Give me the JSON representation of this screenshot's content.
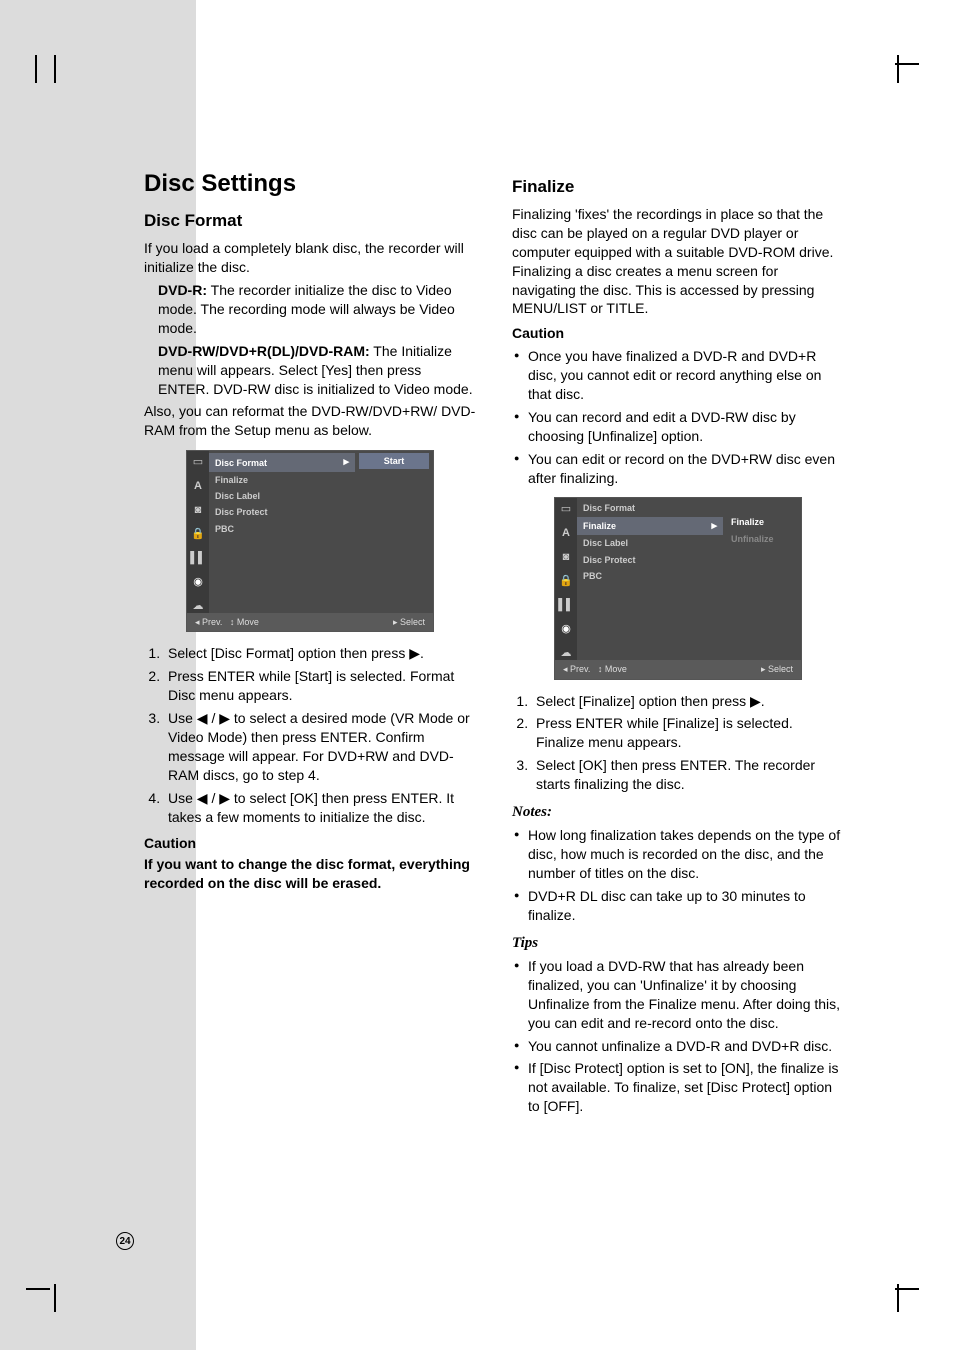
{
  "page_number": "24",
  "left": {
    "title": "Disc Settings",
    "h2": "Disc Format",
    "intro": "If you load a completely blank disc, the recorder will initialize the disc.",
    "dvd_r_label": "DVD-R:",
    "dvd_r_text": " The recorder initialize the disc to Video mode. The recording mode will always be Video mode.",
    "dvd_rw_label": "DVD-RW/DVD+R(DL)/DVD-RAM:",
    "dvd_rw_text": " The Initialize menu will appears. Select [Yes] then press ENTER. DVD-RW disc is initialized to Video mode.",
    "also": "Also, you can reformat the DVD-RW/DVD+RW/ DVD-RAM from the Setup menu as below.",
    "steps": [
      "Select [Disc Format] option then press ▶.",
      "Press ENTER while [Start] is selected. Format Disc menu appears.",
      "Use ◀ / ▶ to select a desired mode (VR Mode or Video Mode) then press ENTER. Confirm message will appear. For DVD+RW and DVD-RAM discs, go to step 4.",
      "Use ◀ / ▶ to select [OK] then press ENTER. It takes a few moments to initialize the disc."
    ],
    "caution_label": "Caution",
    "caution_text": "If you want to change the disc format, everything recorded on the disc will be erased."
  },
  "right": {
    "h2": "Finalize",
    "intro": "Finalizing 'fixes' the recordings in place so that the disc can be played on a regular DVD player or computer equipped with a suitable DVD-ROM drive. Finalizing a disc creates a menu screen for navigating the disc. This is accessed by pressing MENU/LIST or TITLE.",
    "caution_label": "Caution",
    "caution_bullets": [
      "Once you have finalized a DVD-R and DVD+R disc, you cannot edit or record anything else on that disc.",
      "You can record and edit a DVD-RW disc by choosing [Unfinalize] option.",
      "You can edit or record on the DVD+RW disc even after finalizing."
    ],
    "steps": [
      "Select [Finalize] option then press ▶.",
      "Press ENTER while [Finalize] is selected. Finalize menu appears.",
      "Select [OK] then press ENTER. The recorder starts finalizing the disc."
    ],
    "notes_label": "Notes:",
    "notes_bullets": [
      "How long finalization takes depends on the type of disc, how much is recorded on the disc, and the number of titles on the disc.",
      "DVD+R DL disc can take up to 30 minutes to finalize."
    ],
    "tips_label": "Tips",
    "tips_bullets": [
      "If you load a DVD-RW that has already been finalized, you can 'Unfinalize' it by choosing Unfinalize from the Finalize menu. After doing this, you can edit and re-record onto the disc.",
      "You cannot unfinalize a DVD-R and DVD+R disc.",
      "If [Disc Protect] option is set to [ON], the finalize is not available. To finalize, set [Disc Protect] option to [OFF]."
    ]
  },
  "osd": {
    "menu_items": [
      "Disc Format",
      "Finalize",
      "Disc Label",
      "Disc Protect",
      "PBC"
    ],
    "start_btn": "Start",
    "finalize_btn": "Finalize",
    "unfinalize_btn": "Unfinalize",
    "foot_prev": "◂ Prev.",
    "foot_move": "↕ Move",
    "foot_select": "▸ Select",
    "arrow": "▸"
  }
}
